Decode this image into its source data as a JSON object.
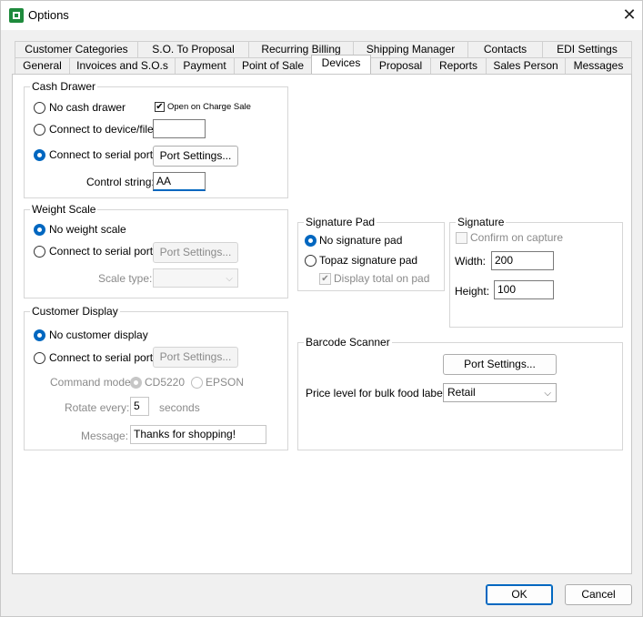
{
  "window": {
    "title": "Options",
    "close_glyph": "✕"
  },
  "tabs": {
    "row1": [
      "Customer Categories",
      "S.O. To Proposal",
      "Recurring Billing",
      "Shipping Manager",
      "Contacts",
      "EDI Settings"
    ],
    "row2": [
      "General",
      "Invoices and S.O.s",
      "Payment",
      "Point of Sale",
      "Devices",
      "Proposal",
      "Reports",
      "Sales Person",
      "Messages"
    ],
    "active": "Devices"
  },
  "cash_drawer": {
    "title": "Cash Drawer",
    "no_drawer": "No cash drawer",
    "open_on_charge": "Open on Charge Sale",
    "open_on_charge_checked": true,
    "device_file": "Connect to device/file:",
    "device_file_value": "",
    "serial_port": "Connect to serial port:",
    "selected": "serial_port",
    "port_settings": "Port Settings...",
    "control_string_label": "Control string:",
    "control_string_value": "AA"
  },
  "weight_scale": {
    "title": "Weight Scale",
    "no_scale": "No weight scale",
    "serial_port": "Connect to serial port:",
    "selected": "no_scale",
    "port_settings": "Port Settings...",
    "scale_type_label": "Scale type:",
    "scale_type_value": ""
  },
  "customer_display": {
    "title": "Customer Display",
    "no_display": "No customer display",
    "serial_port": "Connect to serial port:",
    "selected": "no_display",
    "port_settings": "Port Settings...",
    "command_mode_label": "Command mode:",
    "mode_cd5220": "CD5220",
    "mode_epson": "EPSON",
    "rotate_label": "Rotate every:",
    "rotate_value": "5",
    "rotate_unit": "seconds",
    "message_label": "Message:",
    "message_value": "Thanks for shopping!"
  },
  "signature_pad": {
    "title": "Signature Pad",
    "no_pad": "No signature pad",
    "topaz": "Topaz signature pad",
    "selected": "no_pad",
    "display_total": "Display total on pad",
    "display_total_checked": true
  },
  "signature": {
    "title": "Signature",
    "confirm": "Confirm on capture",
    "confirm_checked": false,
    "width_label": "Width:",
    "width_value": "200",
    "height_label": "Height:",
    "height_value": "100"
  },
  "barcode": {
    "title": "Barcode Scanner",
    "port_settings": "Port Settings...",
    "price_level_label": "Price level for bulk food label:",
    "price_level_value": "Retail"
  },
  "footer": {
    "ok": "OK",
    "cancel": "Cancel"
  },
  "icons": {
    "check_glyph": "✔",
    "chevron_glyph": "⌵"
  },
  "colors": {
    "accent": "#0067c0",
    "app_icon": "#1e8a3c"
  }
}
